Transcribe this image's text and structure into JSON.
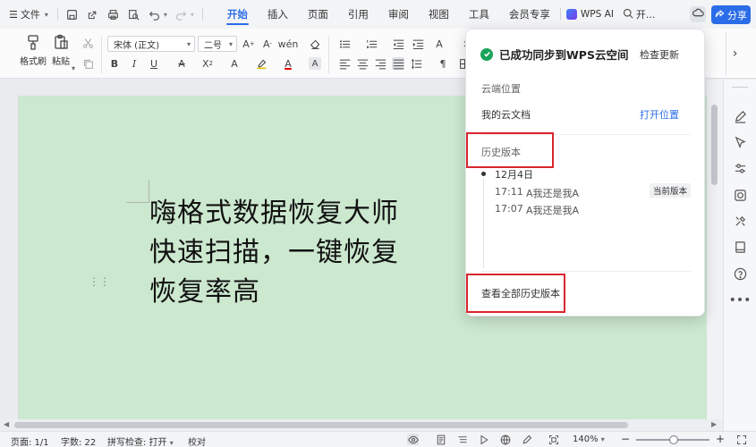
{
  "menubar": {
    "file_label": "文件",
    "tabs": [
      {
        "label": "开始",
        "active": true
      },
      {
        "label": "插入",
        "active": false
      },
      {
        "label": "页面",
        "active": false
      },
      {
        "label": "引用",
        "active": false
      },
      {
        "label": "审阅",
        "active": false
      },
      {
        "label": "视图",
        "active": false
      },
      {
        "label": "工具",
        "active": false
      },
      {
        "label": "会员专享",
        "active": false
      }
    ],
    "wps_ai_label": "WPS AI",
    "search_label": "开...",
    "share_label": "分享"
  },
  "ribbon": {
    "format_painter_label": "格式刷",
    "paste_label": "粘贴",
    "font_name": "宋体 (正文)",
    "font_size": "二号"
  },
  "document": {
    "lines": [
      "嗨格式数据恢复大师",
      "快速扫描，一键恢复",
      "恢复率高"
    ]
  },
  "popup": {
    "title": "已成功同步到WPS云空间",
    "check_update": "检查更新",
    "cloud_location_label": "云端位置",
    "my_docs": "我的云文档",
    "open_location": "打开位置",
    "history_label": "历史版本",
    "date": "12月4日",
    "versions": [
      {
        "time": "17:11",
        "desc": "A我还是我A",
        "current": true
      },
      {
        "time": "17:07",
        "desc": "A我还是我A",
        "current": false
      }
    ],
    "current_badge": "当前版本",
    "view_all": "查看全部历史版本"
  },
  "statusbar": {
    "page": "页面: 1/1",
    "words": "字数: 22",
    "spell": "拼写检查: 打开",
    "proof": "校对",
    "zoom": "140%"
  },
  "colors": {
    "accent": "#2b6de8",
    "page_bg": "#cce8cf",
    "highlight": "#d9262e",
    "success": "#1aa35a"
  }
}
